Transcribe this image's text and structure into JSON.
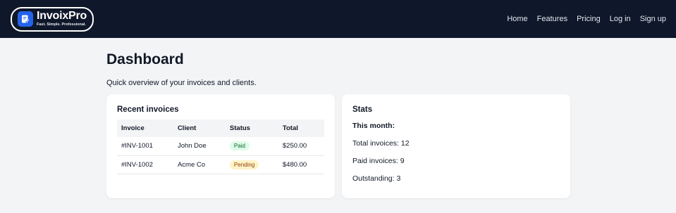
{
  "header": {
    "brand_name": "InvoixPro",
    "brand_tagline": "Fast. Simple. Professional.",
    "nav": [
      "Home",
      "Features",
      "Pricing",
      "Log in",
      "Sign up"
    ]
  },
  "page": {
    "title": "Dashboard",
    "subtitle": "Quick overview of your invoices and clients."
  },
  "invoices_card": {
    "title": "Recent invoices",
    "columns": [
      "Invoice",
      "Client",
      "Status",
      "Total"
    ],
    "rows": [
      {
        "invoice": "#INV-1001",
        "client": "John Doe",
        "status": "Paid",
        "total": "$250.00"
      },
      {
        "invoice": "#INV-1002",
        "client": "Acme Co",
        "status": "Pending",
        "total": "$480.00"
      }
    ]
  },
  "stats_card": {
    "title": "Stats",
    "period_label": "This month:",
    "total_invoices": "Total invoices: 12",
    "paid_invoices": "Paid invoices: 9",
    "outstanding": "Outstanding: 3"
  },
  "colors": {
    "header_bg": "#0f172a",
    "brand_badge": "#2563eb",
    "paid_pill": "#dcfce7",
    "pending_pill": "#fef3c7"
  }
}
